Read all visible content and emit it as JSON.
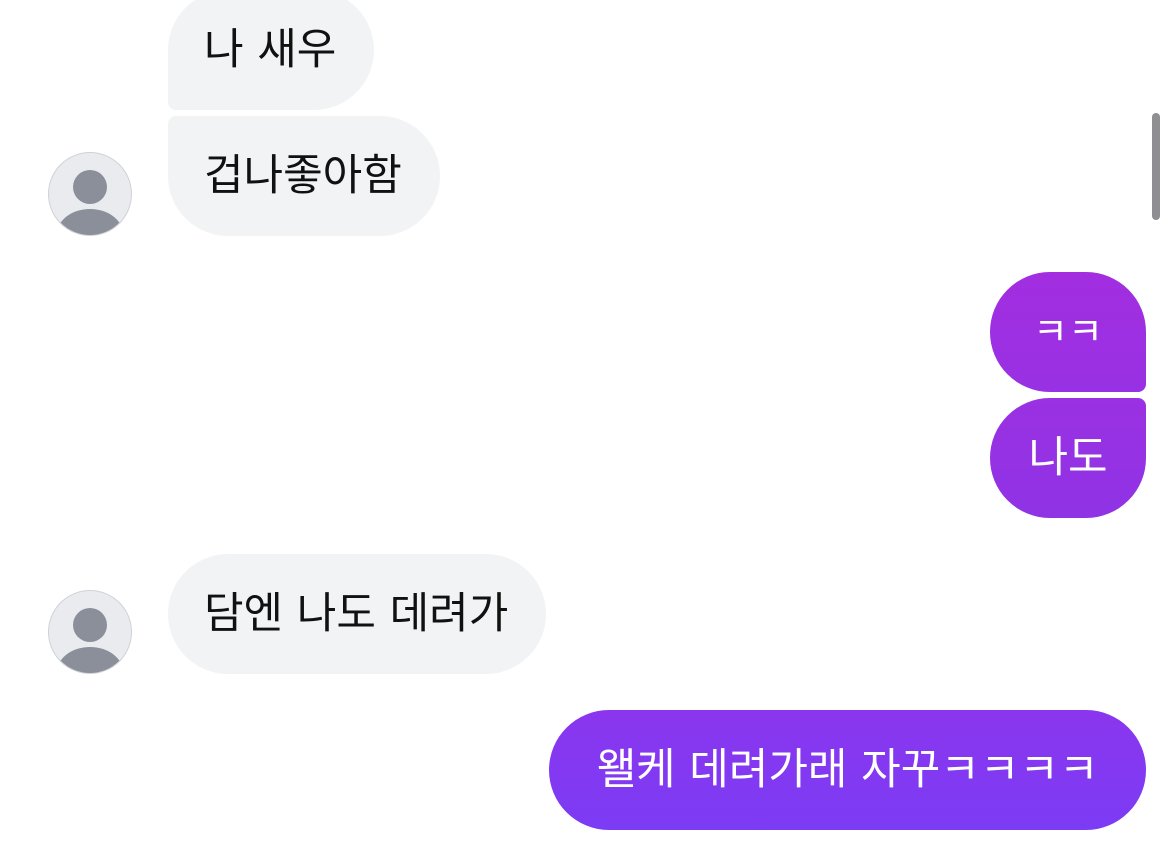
{
  "messages": {
    "m1": "나 새우",
    "m2": "겁나좋아함",
    "m3": "ㅋㅋ",
    "m4": "나도",
    "m5": "담엔 나도 데려가",
    "m6": "왤케 데려가래 자꾸ㅋㅋㅋㅋ"
  },
  "colors": {
    "incoming_bubble": "#f2f3f5",
    "outgoing_gradient_top": "#a22ee0",
    "outgoing_gradient_bottom": "#7b3cf3"
  },
  "icons": {
    "avatar": "default-user-avatar-icon"
  }
}
